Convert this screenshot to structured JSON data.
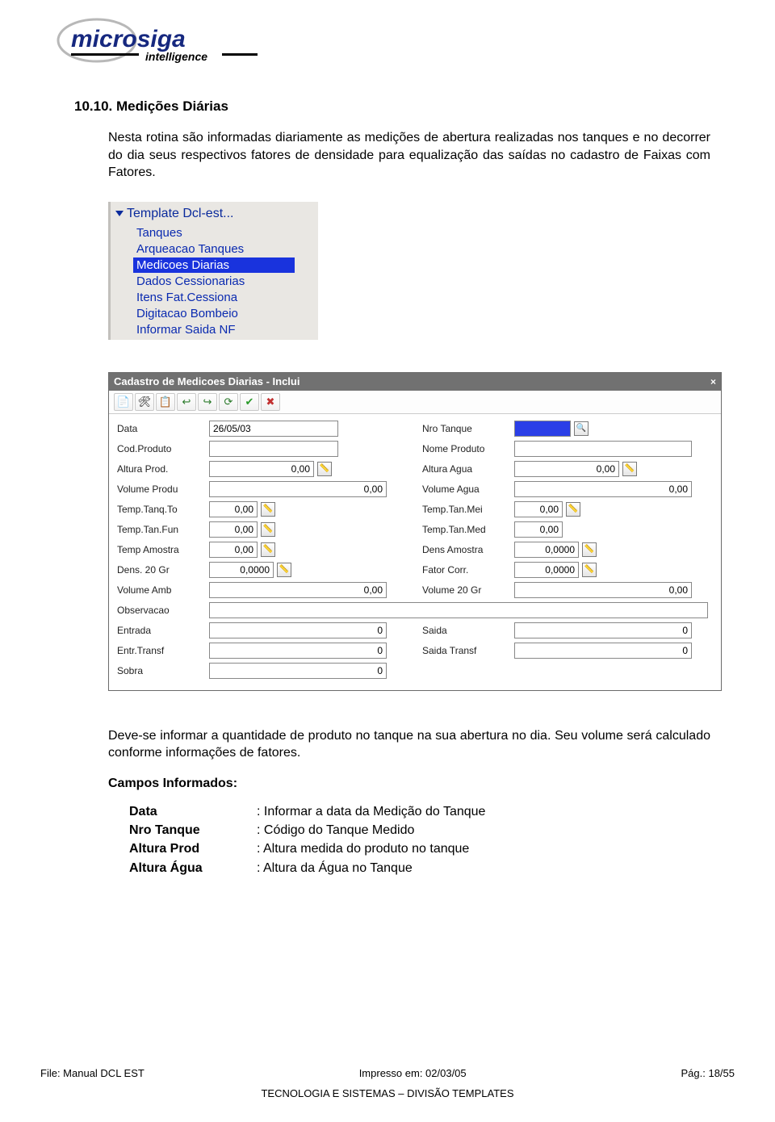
{
  "logo": {
    "brand": "microsiga",
    "sub": "intelligence"
  },
  "section": {
    "number": "10.10.",
    "title": "Medições Diárias",
    "intro": "Nesta rotina são informadas diariamente as medições de abertura realizadas nos tanques e no decorrer do dia seus respectivos fatores de densidade para equalização das saídas no cadastro de Faixas com Fatores."
  },
  "template_menu": {
    "header": "Template Dcl-est...",
    "items": [
      {
        "label": "Tanques",
        "selected": false
      },
      {
        "label": "Arqueacao Tanques",
        "selected": false
      },
      {
        "label": "Medicoes Diarias",
        "selected": true
      },
      {
        "label": "Dados Cessionarias",
        "selected": false
      },
      {
        "label": "Itens Fat.Cessiona",
        "selected": false
      },
      {
        "label": "Digitacao Bombeio",
        "selected": false
      },
      {
        "label": "Informar Saida NF",
        "selected": false
      }
    ]
  },
  "form": {
    "title": "Cadastro de Medicoes Diarias - Inclui",
    "close": "×",
    "toolbar_icons": [
      "new-icon",
      "tool-icon",
      "copy-icon",
      "undo-icon",
      "redo-icon",
      "refresh-icon",
      "accept-icon",
      "cancel-icon"
    ],
    "fields": {
      "row1": {
        "l1": "Data",
        "v1": "26/05/03",
        "l2": "Nro Tanque",
        "v2": ""
      },
      "row2": {
        "l1": "Cod.Produto",
        "v1": "",
        "l2": "Nome Produto",
        "v2": ""
      },
      "row3": {
        "l1": "Altura Prod.",
        "v1": "0,00",
        "l2": "Altura Agua",
        "v2": "0,00"
      },
      "row4": {
        "l1": "Volume Produ",
        "v1": "0,00",
        "l2": "Volume Agua",
        "v2": "0,00"
      },
      "row5": {
        "l1": "Temp.Tanq.To",
        "v1": "0,00",
        "l2": "Temp.Tan.Mei",
        "v2": "0,00"
      },
      "row6": {
        "l1": "Temp.Tan.Fun",
        "v1": "0,00",
        "l2": "Temp.Tan.Med",
        "v2": "0,00"
      },
      "row7": {
        "l1": "Temp Amostra",
        "v1": "0,00",
        "l2": "Dens Amostra",
        "v2": "0,0000"
      },
      "row8": {
        "l1": "Dens. 20 Gr",
        "v1": "0,0000",
        "l2": "Fator Corr.",
        "v2": "0,0000"
      },
      "row9": {
        "l1": "Volume Amb",
        "v1": "0,00",
        "l2": "Volume 20 Gr",
        "v2": "0,00"
      },
      "row10": {
        "l1": "Observacao",
        "v1": ""
      },
      "row11": {
        "l1": "Entrada",
        "v1": "0",
        "l2": "Saida",
        "v2": "0"
      },
      "row12": {
        "l1": "Entr.Transf",
        "v1": "0",
        "l2": "Saida Transf",
        "v2": "0"
      },
      "row13": {
        "l1": "Sobra",
        "v1": "0"
      }
    }
  },
  "post_form": {
    "para": "Deve-se informar a quantidade de produto no tanque na sua abertura no dia. Seu volume será calculado conforme informações de fatores.",
    "campos_title": "Campos Informados:",
    "campos": [
      {
        "k": "Data",
        "v": ": Informar a data da Medição do Tanque"
      },
      {
        "k": "Nro Tanque",
        "v": ": Código do Tanque Medido"
      },
      {
        "k": "Altura Prod",
        "v": ": Altura medida do produto no tanque"
      },
      {
        "k": "Altura Água",
        "v": ": Altura da Água no Tanque"
      }
    ]
  },
  "footer": {
    "file": "File: Manual DCL EST",
    "impresso": "Impresso em: 02/03/05",
    "pag": "Pág.: 18/55",
    "line2": "TECNOLOGIA E SISTEMAS – DIVISÃO TEMPLATES"
  }
}
